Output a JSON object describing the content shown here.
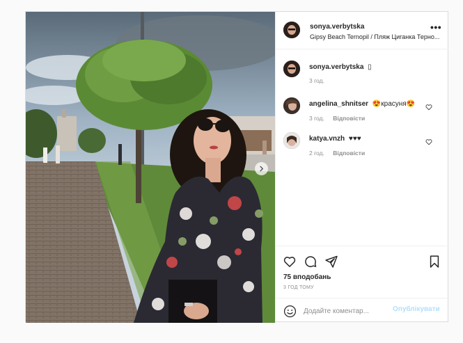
{
  "post": {
    "author": "sonya.verbytska",
    "location": "Gipsy Beach Ternopil / Пляж Циганка Терно...",
    "more_icon": "•••",
    "caption": {
      "user": "sonya.verbytska",
      "text": "▯",
      "time": "3 год."
    },
    "comments": [
      {
        "user": "angelina_shnitser",
        "text": "😍красуня😍",
        "time": "3 год.",
        "reply": "Відповісти"
      },
      {
        "user": "katya.vnzh",
        "text": "♥♥♥",
        "time": "2 год.",
        "reply": "Відповісти"
      }
    ],
    "likes": "75 вподобань",
    "posted": "3 ГОД ТОМУ",
    "add_comment": {
      "placeholder": "Додайте коментар...",
      "value": "",
      "publish": "Опублікувати"
    }
  },
  "icons": {
    "like": "heart-icon",
    "comment": "comment-icon",
    "share": "share-icon",
    "save": "bookmark-icon",
    "emoji": "emoji-icon",
    "next": "chevron-right-icon"
  },
  "colors": {
    "border": "#dbdbdb",
    "muted": "#8e8e8e",
    "publish_disabled": "#b2dffc",
    "text": "#262626"
  }
}
